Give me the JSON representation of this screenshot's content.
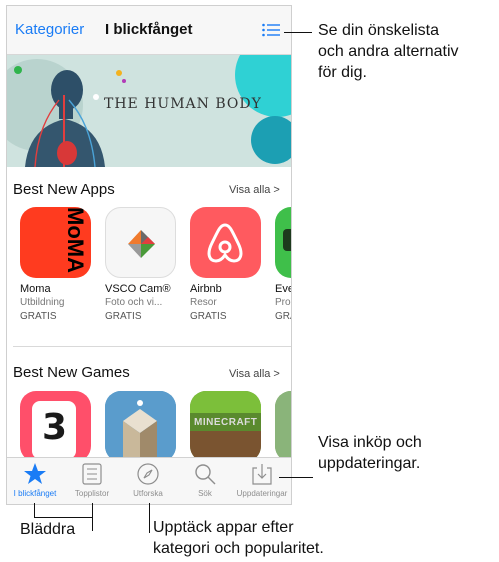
{
  "navbar": {
    "left": "Kategorier",
    "title": "I blickfånget"
  },
  "banner": {
    "title": "THE HUMAN BODY"
  },
  "sections": [
    {
      "title": "Best New Apps",
      "more": "Visa alla >",
      "apps": [
        {
          "name": "Moma",
          "sub": "Utbildning",
          "price": "GRATIS",
          "icon_text": "MoMA"
        },
        {
          "name": "VSCO Cam®",
          "sub": "Foto och vi...",
          "price": "GRATIS"
        },
        {
          "name": "Airbnb",
          "sub": "Resor",
          "price": "GRATIS"
        },
        {
          "name": "Eve",
          "sub": "Prod",
          "price": "GRA"
        }
      ]
    },
    {
      "title": "Best New Games",
      "more": "Visa alla >",
      "games": [
        {
          "icon_text": "3"
        },
        {
          "icon_text": ""
        },
        {
          "icon_text": "MINECRAFT"
        },
        {
          "icon_text": ""
        }
      ]
    }
  ],
  "tabs": [
    {
      "label": "I blickfånget",
      "icon": "star-icon",
      "active": true
    },
    {
      "label": "Topplistor",
      "icon": "list-icon"
    },
    {
      "label": "Utforska",
      "icon": "compass-icon"
    },
    {
      "label": "Sök",
      "icon": "search-icon"
    },
    {
      "label": "Uppdateringar",
      "icon": "download-icon"
    }
  ],
  "callouts": {
    "wishlist": [
      "Se din önskelista",
      "och andra alternativ",
      "för dig."
    ],
    "purchases": [
      "Visa inköp och",
      "uppdateringar."
    ],
    "browse": "Bläddra",
    "discover": [
      "Upptäck appar efter",
      "kategori och popularitet."
    ]
  },
  "colors": {
    "accent": "#1a7cf5",
    "banner_bg": "#cfe3df",
    "moma": "#ff3b1f",
    "airbnb": "#ff5a5f"
  }
}
